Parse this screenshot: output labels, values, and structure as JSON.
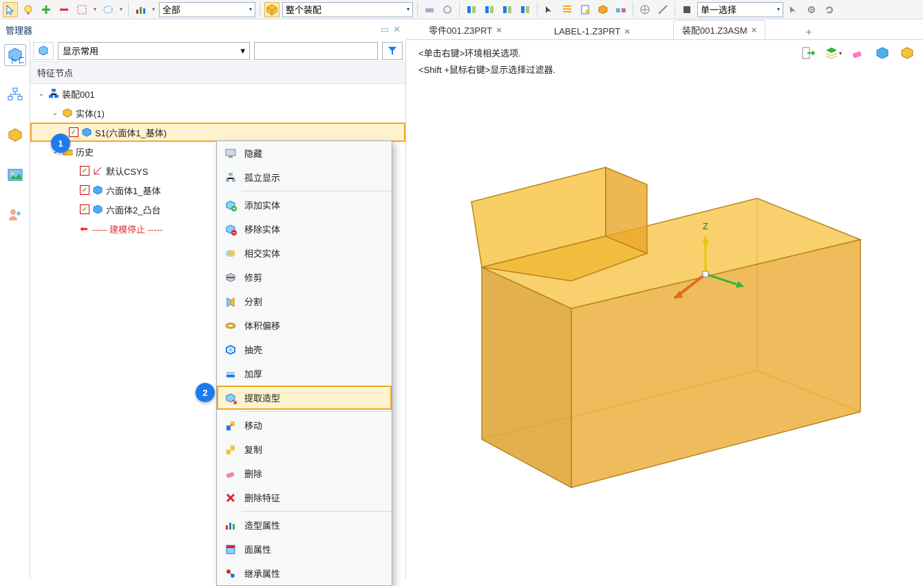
{
  "toolbar": {
    "sel1_combo": "全部",
    "sel2_combo": "整个装配",
    "right_combo": "单一选择"
  },
  "manager": {
    "title": "管理器"
  },
  "tabs": [
    {
      "label": "零件001.Z3PRT",
      "active": false
    },
    {
      "label": "LABEL-1.Z3PRT",
      "active": false
    },
    {
      "label": "装配001.Z3ASM",
      "active": true
    }
  ],
  "tree": {
    "display_combo": "显示常用",
    "section_head": "特征节点",
    "root": "装配001",
    "solid_group": "实体(1)",
    "s1_item": "S1(六面体1_基体)",
    "history_group": "历史",
    "csys": "默认CSYS",
    "hex1": "六面体1_基体",
    "hex2": "六面体2_凸台",
    "stop_label": "----- 建模停止 -----"
  },
  "context_menu": {
    "items": [
      {
        "icon": "monitor-icon",
        "label": "隐藏"
      },
      {
        "icon": "isolate-icon",
        "label": "孤立显示"
      },
      {
        "sep": true
      },
      {
        "icon": "add-body-icon",
        "label": "添加实体"
      },
      {
        "icon": "remove-body-icon",
        "label": "移除实体"
      },
      {
        "icon": "intersect-icon",
        "label": "相交实体"
      },
      {
        "icon": "trim-icon",
        "label": "修剪"
      },
      {
        "icon": "split-icon",
        "label": "分割"
      },
      {
        "icon": "offset-icon",
        "label": "体积偏移"
      },
      {
        "icon": "shell-icon",
        "label": "抽壳"
      },
      {
        "icon": "thicken-icon",
        "label": "加厚"
      },
      {
        "icon": "extract-icon",
        "label": "提取造型",
        "highlight": true
      },
      {
        "sep": true
      },
      {
        "icon": "move-icon",
        "label": "移动"
      },
      {
        "icon": "copy-icon",
        "label": "复制"
      },
      {
        "icon": "erase-icon",
        "label": "删除"
      },
      {
        "icon": "delf-icon",
        "label": "删除特征"
      },
      {
        "sep": true
      },
      {
        "icon": "shape-attr-icon",
        "label": "造型属性"
      },
      {
        "icon": "face-attr-icon",
        "label": "面属性"
      },
      {
        "icon": "inherit-icon",
        "label": "继承属性"
      }
    ]
  },
  "viewport": {
    "hint1": "<单击右键>环境相关选项.",
    "hint2": "<Shift +鼠标右键>显示选择过滤器.",
    "axis_z": "Z"
  },
  "badges": {
    "one": "1",
    "two": "2"
  }
}
